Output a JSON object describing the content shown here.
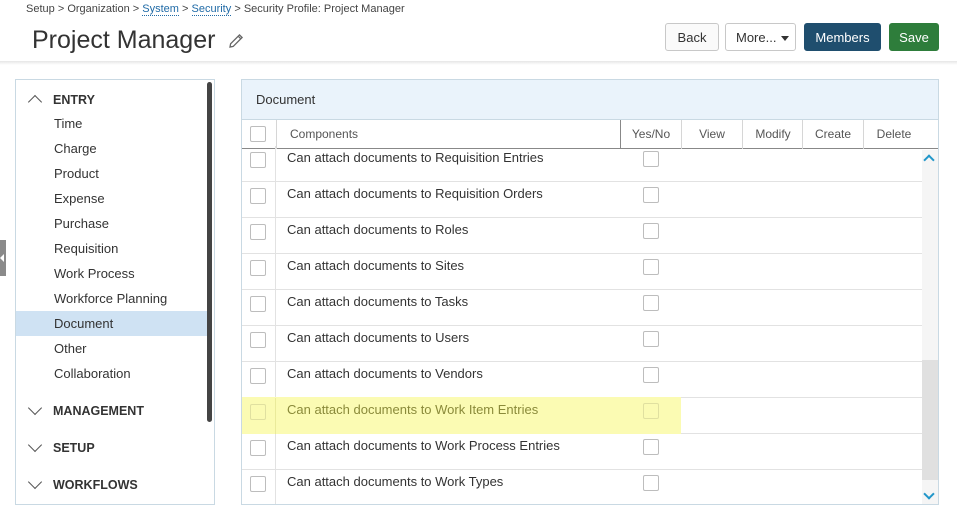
{
  "breadcrumb": {
    "setup": "Setup",
    "sep1": ">",
    "organization": "Organization",
    "sep2": ">",
    "system": "System",
    "sep3": ">",
    "security": "Security",
    "sep4": ">",
    "current": "Security Profile: Project Manager"
  },
  "header": {
    "title": "Project Manager",
    "back_label": "Back",
    "more_label": "More...",
    "members_label": "Members",
    "save_label": "Save"
  },
  "sidebar": {
    "sections": [
      {
        "label": "ENTRY",
        "expanded": true
      },
      {
        "label": "MANAGEMENT",
        "expanded": false
      },
      {
        "label": "SETUP",
        "expanded": false
      },
      {
        "label": "WORKFLOWS",
        "expanded": false
      }
    ],
    "items": [
      {
        "label": "Time"
      },
      {
        "label": "Charge"
      },
      {
        "label": "Product"
      },
      {
        "label": "Expense"
      },
      {
        "label": "Purchase"
      },
      {
        "label": "Requisition"
      },
      {
        "label": "Work Process"
      },
      {
        "label": "Workforce Planning"
      },
      {
        "label": "Document",
        "active": true
      },
      {
        "label": "Other"
      },
      {
        "label": "Collaboration"
      }
    ]
  },
  "panel": {
    "title": "Document",
    "columns": {
      "components": "Components",
      "yesno": "Yes/No",
      "view": "View",
      "modify": "Modify",
      "create": "Create",
      "delete": "Delete"
    },
    "rows": [
      {
        "label": "Can attach documents to Requisition Entries"
      },
      {
        "label": "Can attach documents to Requisition Orders"
      },
      {
        "label": "Can attach documents to Roles"
      },
      {
        "label": "Can attach documents to Sites"
      },
      {
        "label": "Can attach documents to Tasks"
      },
      {
        "label": "Can attach documents to Users"
      },
      {
        "label": "Can attach documents to Vendors"
      },
      {
        "label": "Can attach documents to Work Item Entries",
        "highlighted": true
      },
      {
        "label": "Can attach documents to Work Process Entries"
      },
      {
        "label": "Can attach documents to Work Types"
      }
    ]
  },
  "colors": {
    "members_button": "#1f4e6e",
    "save_button": "#2e7d3b",
    "active_nav": "#cfe2f3",
    "highlight_row": "#fbfbb3",
    "link": "#1f6aa6"
  }
}
